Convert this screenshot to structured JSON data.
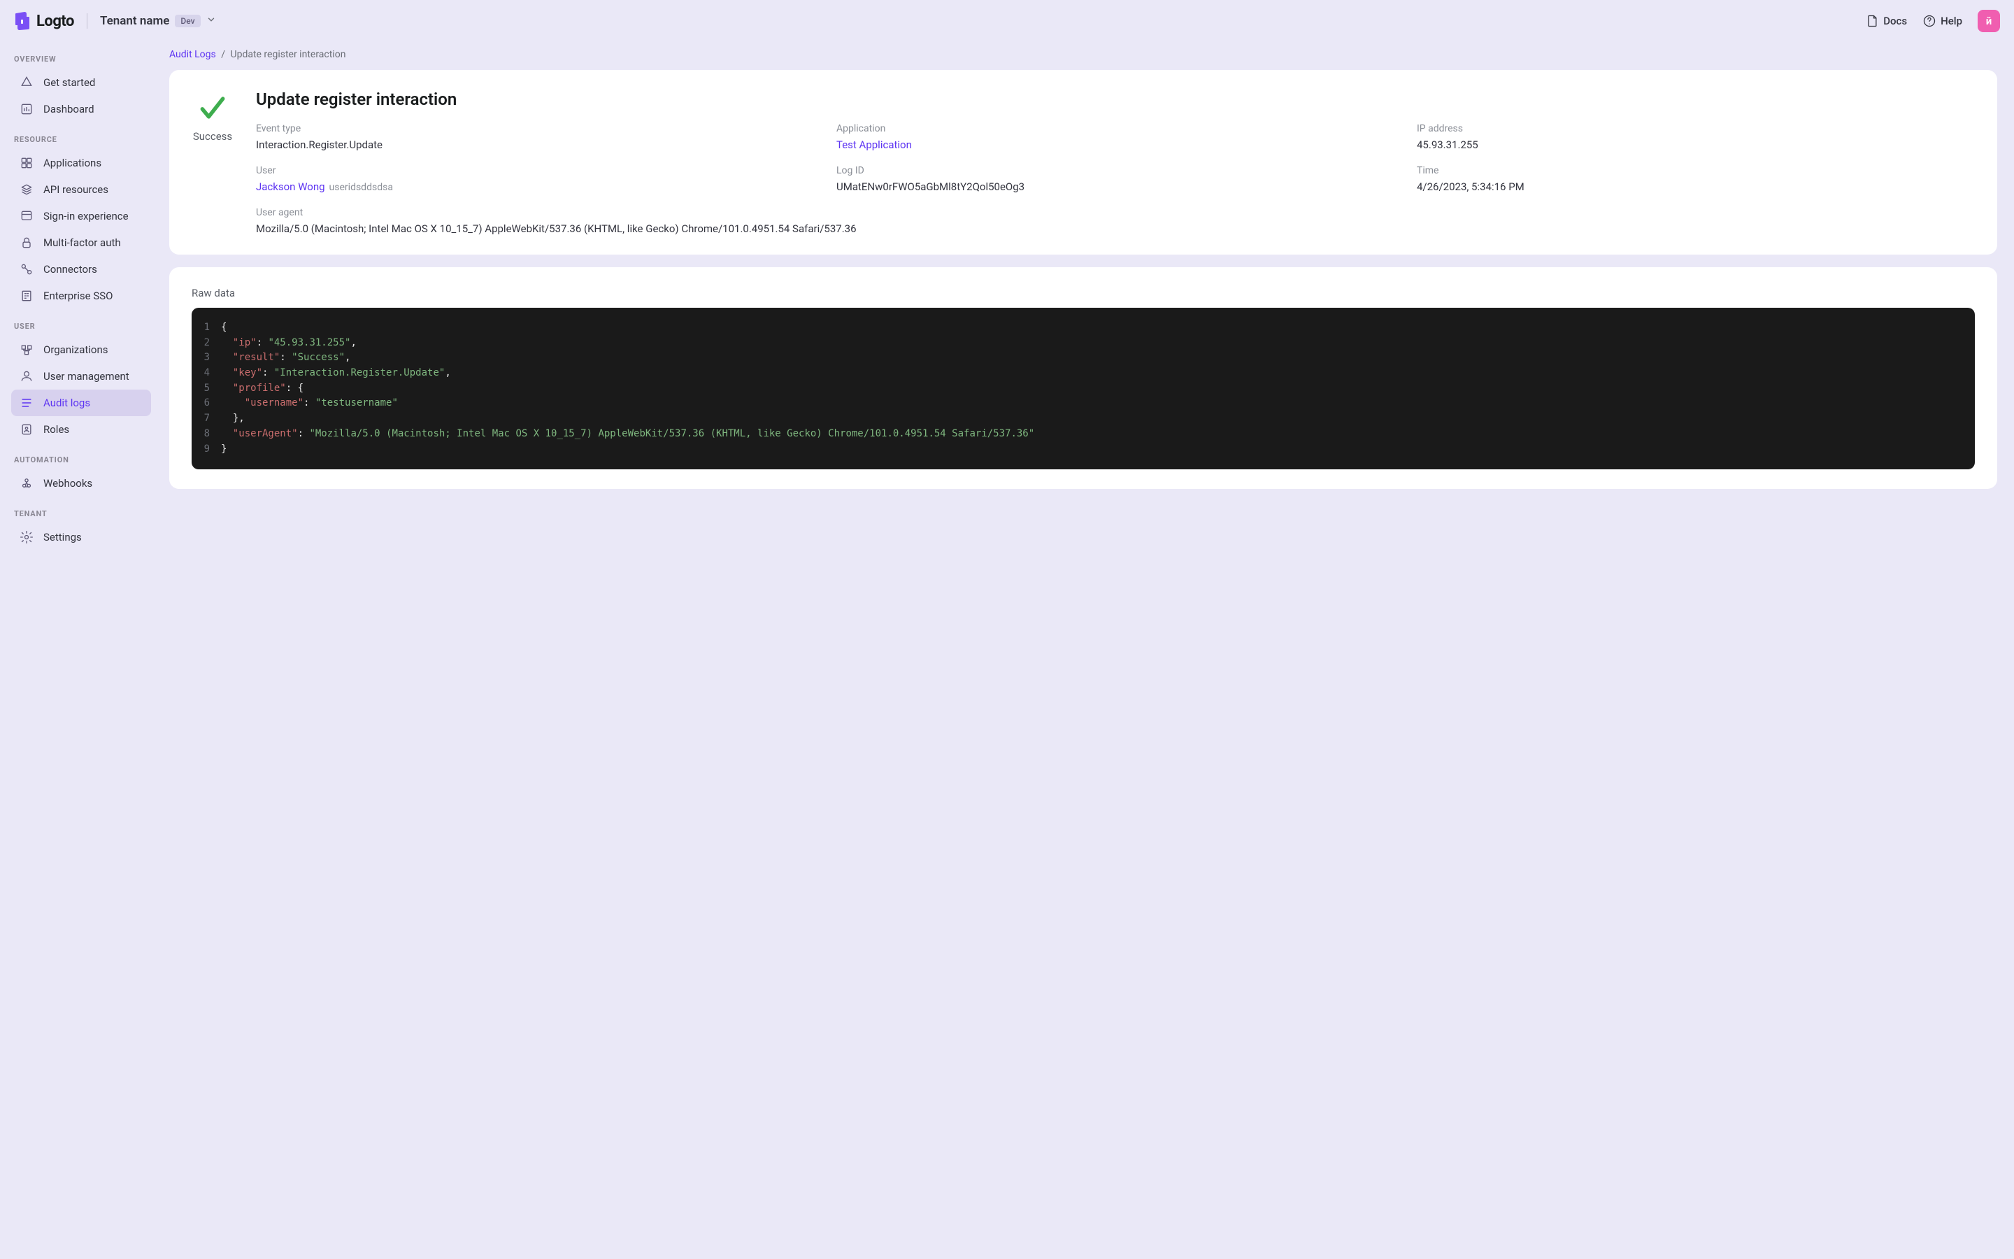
{
  "brand": "Logto",
  "tenant": {
    "name": "Tenant name",
    "badge": "Dev"
  },
  "topbar": {
    "docs": "Docs",
    "help": "Help",
    "avatar_initial": "й"
  },
  "sidebar": {
    "sections": [
      {
        "label": "OVERVIEW",
        "items": [
          {
            "key": "get-started",
            "label": "Get started"
          },
          {
            "key": "dashboard",
            "label": "Dashboard"
          }
        ]
      },
      {
        "label": "RESOURCE",
        "items": [
          {
            "key": "applications",
            "label": "Applications"
          },
          {
            "key": "api-resources",
            "label": "API resources"
          },
          {
            "key": "sign-in-exp",
            "label": "Sign-in experience"
          },
          {
            "key": "mfa",
            "label": "Multi-factor auth"
          },
          {
            "key": "connectors",
            "label": "Connectors"
          },
          {
            "key": "enterprise-sso",
            "label": "Enterprise SSO"
          }
        ]
      },
      {
        "label": "USER",
        "items": [
          {
            "key": "organizations",
            "label": "Organizations"
          },
          {
            "key": "user-mgmt",
            "label": "User management"
          },
          {
            "key": "audit-logs",
            "label": "Audit logs",
            "active": true
          },
          {
            "key": "roles",
            "label": "Roles"
          }
        ]
      },
      {
        "label": "AUTOMATION",
        "items": [
          {
            "key": "webhooks",
            "label": "Webhooks"
          }
        ]
      },
      {
        "label": "TENANT",
        "items": [
          {
            "key": "settings",
            "label": "Settings"
          }
        ]
      }
    ]
  },
  "breadcrumb": {
    "parent": "Audit Logs",
    "sep": "/",
    "current": "Update register interaction"
  },
  "detail": {
    "title": "Update register interaction",
    "status": "Success",
    "event_type_label": "Event type",
    "event_type": "Interaction.Register.Update",
    "application_label": "Application",
    "application": "Test Application",
    "ip_label": "IP address",
    "ip": "45.93.31.255",
    "user_label": "User",
    "user_name": "Jackson Wong",
    "user_id": "useridsddsdsa",
    "log_id_label": "Log ID",
    "log_id": "UMatENw0rFWO5aGbMl8tY2Qol50eOg3",
    "time_label": "Time",
    "time": "4/26/2023, 5:34:16 PM",
    "ua_label": "User agent",
    "ua": "Mozilla/5.0 (Macintosh; Intel Mac OS X 10_15_7) AppleWebKit/537.36 (KHTML, like Gecko) Chrome/101.0.4951.54 Safari/537.36"
  },
  "raw": {
    "title": "Raw data",
    "json": {
      "ip": "45.93.31.255",
      "result": "Success",
      "key": "Interaction.Register.Update",
      "profile": {
        "username": "testusername"
      },
      "userAgent": "Mozilla/5.0 (Macintosh; Intel Mac OS X 10_15_7) AppleWebKit/537.36 (KHTML, like Gecko) Chrome/101.0.4951.54 Safari/537.36"
    }
  }
}
